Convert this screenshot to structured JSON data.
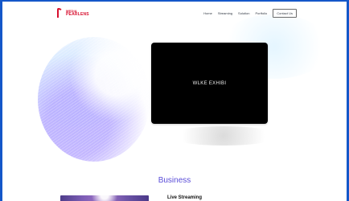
{
  "brand": {
    "top_text": "MEDIA",
    "bottom_text": "PEARLENS"
  },
  "nav": {
    "items": [
      "Home",
      "Streaming",
      "Solution",
      "Portfolio"
    ],
    "contact_label": "Contact Us"
  },
  "hero": {
    "video_text": "WLKE EXHIBI"
  },
  "section": {
    "title": "Business"
  },
  "card": {
    "title": "Live Streaming"
  },
  "colors": {
    "brand": "#d70f2e",
    "accent": "#5a4dd8",
    "frame": "#1457c9"
  }
}
